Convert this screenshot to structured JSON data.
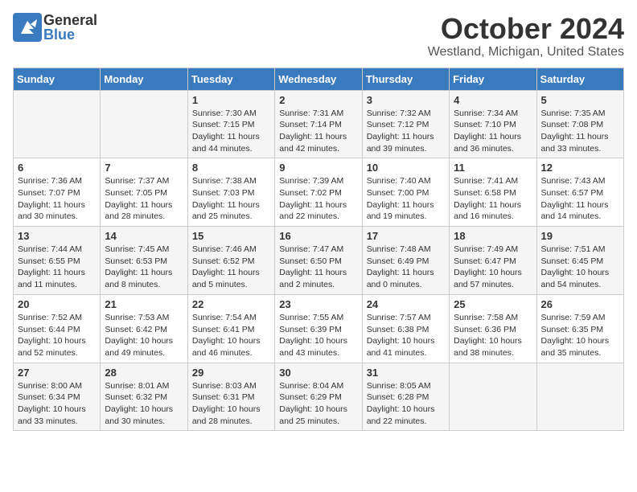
{
  "logo": {
    "general": "General",
    "blue": "Blue"
  },
  "title": "October 2024",
  "subtitle": "Westland, Michigan, United States",
  "days_of_week": [
    "Sunday",
    "Monday",
    "Tuesday",
    "Wednesday",
    "Thursday",
    "Friday",
    "Saturday"
  ],
  "weeks": [
    [
      {
        "day": "",
        "info": ""
      },
      {
        "day": "",
        "info": ""
      },
      {
        "day": "1",
        "info": "Sunrise: 7:30 AM\nSunset: 7:15 PM\nDaylight: 11 hours and 44 minutes."
      },
      {
        "day": "2",
        "info": "Sunrise: 7:31 AM\nSunset: 7:14 PM\nDaylight: 11 hours and 42 minutes."
      },
      {
        "day": "3",
        "info": "Sunrise: 7:32 AM\nSunset: 7:12 PM\nDaylight: 11 hours and 39 minutes."
      },
      {
        "day": "4",
        "info": "Sunrise: 7:34 AM\nSunset: 7:10 PM\nDaylight: 11 hours and 36 minutes."
      },
      {
        "day": "5",
        "info": "Sunrise: 7:35 AM\nSunset: 7:08 PM\nDaylight: 11 hours and 33 minutes."
      }
    ],
    [
      {
        "day": "6",
        "info": "Sunrise: 7:36 AM\nSunset: 7:07 PM\nDaylight: 11 hours and 30 minutes."
      },
      {
        "day": "7",
        "info": "Sunrise: 7:37 AM\nSunset: 7:05 PM\nDaylight: 11 hours and 28 minutes."
      },
      {
        "day": "8",
        "info": "Sunrise: 7:38 AM\nSunset: 7:03 PM\nDaylight: 11 hours and 25 minutes."
      },
      {
        "day": "9",
        "info": "Sunrise: 7:39 AM\nSunset: 7:02 PM\nDaylight: 11 hours and 22 minutes."
      },
      {
        "day": "10",
        "info": "Sunrise: 7:40 AM\nSunset: 7:00 PM\nDaylight: 11 hours and 19 minutes."
      },
      {
        "day": "11",
        "info": "Sunrise: 7:41 AM\nSunset: 6:58 PM\nDaylight: 11 hours and 16 minutes."
      },
      {
        "day": "12",
        "info": "Sunrise: 7:43 AM\nSunset: 6:57 PM\nDaylight: 11 hours and 14 minutes."
      }
    ],
    [
      {
        "day": "13",
        "info": "Sunrise: 7:44 AM\nSunset: 6:55 PM\nDaylight: 11 hours and 11 minutes."
      },
      {
        "day": "14",
        "info": "Sunrise: 7:45 AM\nSunset: 6:53 PM\nDaylight: 11 hours and 8 minutes."
      },
      {
        "day": "15",
        "info": "Sunrise: 7:46 AM\nSunset: 6:52 PM\nDaylight: 11 hours and 5 minutes."
      },
      {
        "day": "16",
        "info": "Sunrise: 7:47 AM\nSunset: 6:50 PM\nDaylight: 11 hours and 2 minutes."
      },
      {
        "day": "17",
        "info": "Sunrise: 7:48 AM\nSunset: 6:49 PM\nDaylight: 11 hours and 0 minutes."
      },
      {
        "day": "18",
        "info": "Sunrise: 7:49 AM\nSunset: 6:47 PM\nDaylight: 10 hours and 57 minutes."
      },
      {
        "day": "19",
        "info": "Sunrise: 7:51 AM\nSunset: 6:45 PM\nDaylight: 10 hours and 54 minutes."
      }
    ],
    [
      {
        "day": "20",
        "info": "Sunrise: 7:52 AM\nSunset: 6:44 PM\nDaylight: 10 hours and 52 minutes."
      },
      {
        "day": "21",
        "info": "Sunrise: 7:53 AM\nSunset: 6:42 PM\nDaylight: 10 hours and 49 minutes."
      },
      {
        "day": "22",
        "info": "Sunrise: 7:54 AM\nSunset: 6:41 PM\nDaylight: 10 hours and 46 minutes."
      },
      {
        "day": "23",
        "info": "Sunrise: 7:55 AM\nSunset: 6:39 PM\nDaylight: 10 hours and 43 minutes."
      },
      {
        "day": "24",
        "info": "Sunrise: 7:57 AM\nSunset: 6:38 PM\nDaylight: 10 hours and 41 minutes."
      },
      {
        "day": "25",
        "info": "Sunrise: 7:58 AM\nSunset: 6:36 PM\nDaylight: 10 hours and 38 minutes."
      },
      {
        "day": "26",
        "info": "Sunrise: 7:59 AM\nSunset: 6:35 PM\nDaylight: 10 hours and 35 minutes."
      }
    ],
    [
      {
        "day": "27",
        "info": "Sunrise: 8:00 AM\nSunset: 6:34 PM\nDaylight: 10 hours and 33 minutes."
      },
      {
        "day": "28",
        "info": "Sunrise: 8:01 AM\nSunset: 6:32 PM\nDaylight: 10 hours and 30 minutes."
      },
      {
        "day": "29",
        "info": "Sunrise: 8:03 AM\nSunset: 6:31 PM\nDaylight: 10 hours and 28 minutes."
      },
      {
        "day": "30",
        "info": "Sunrise: 8:04 AM\nSunset: 6:29 PM\nDaylight: 10 hours and 25 minutes."
      },
      {
        "day": "31",
        "info": "Sunrise: 8:05 AM\nSunset: 6:28 PM\nDaylight: 10 hours and 22 minutes."
      },
      {
        "day": "",
        "info": ""
      },
      {
        "day": "",
        "info": ""
      }
    ]
  ]
}
